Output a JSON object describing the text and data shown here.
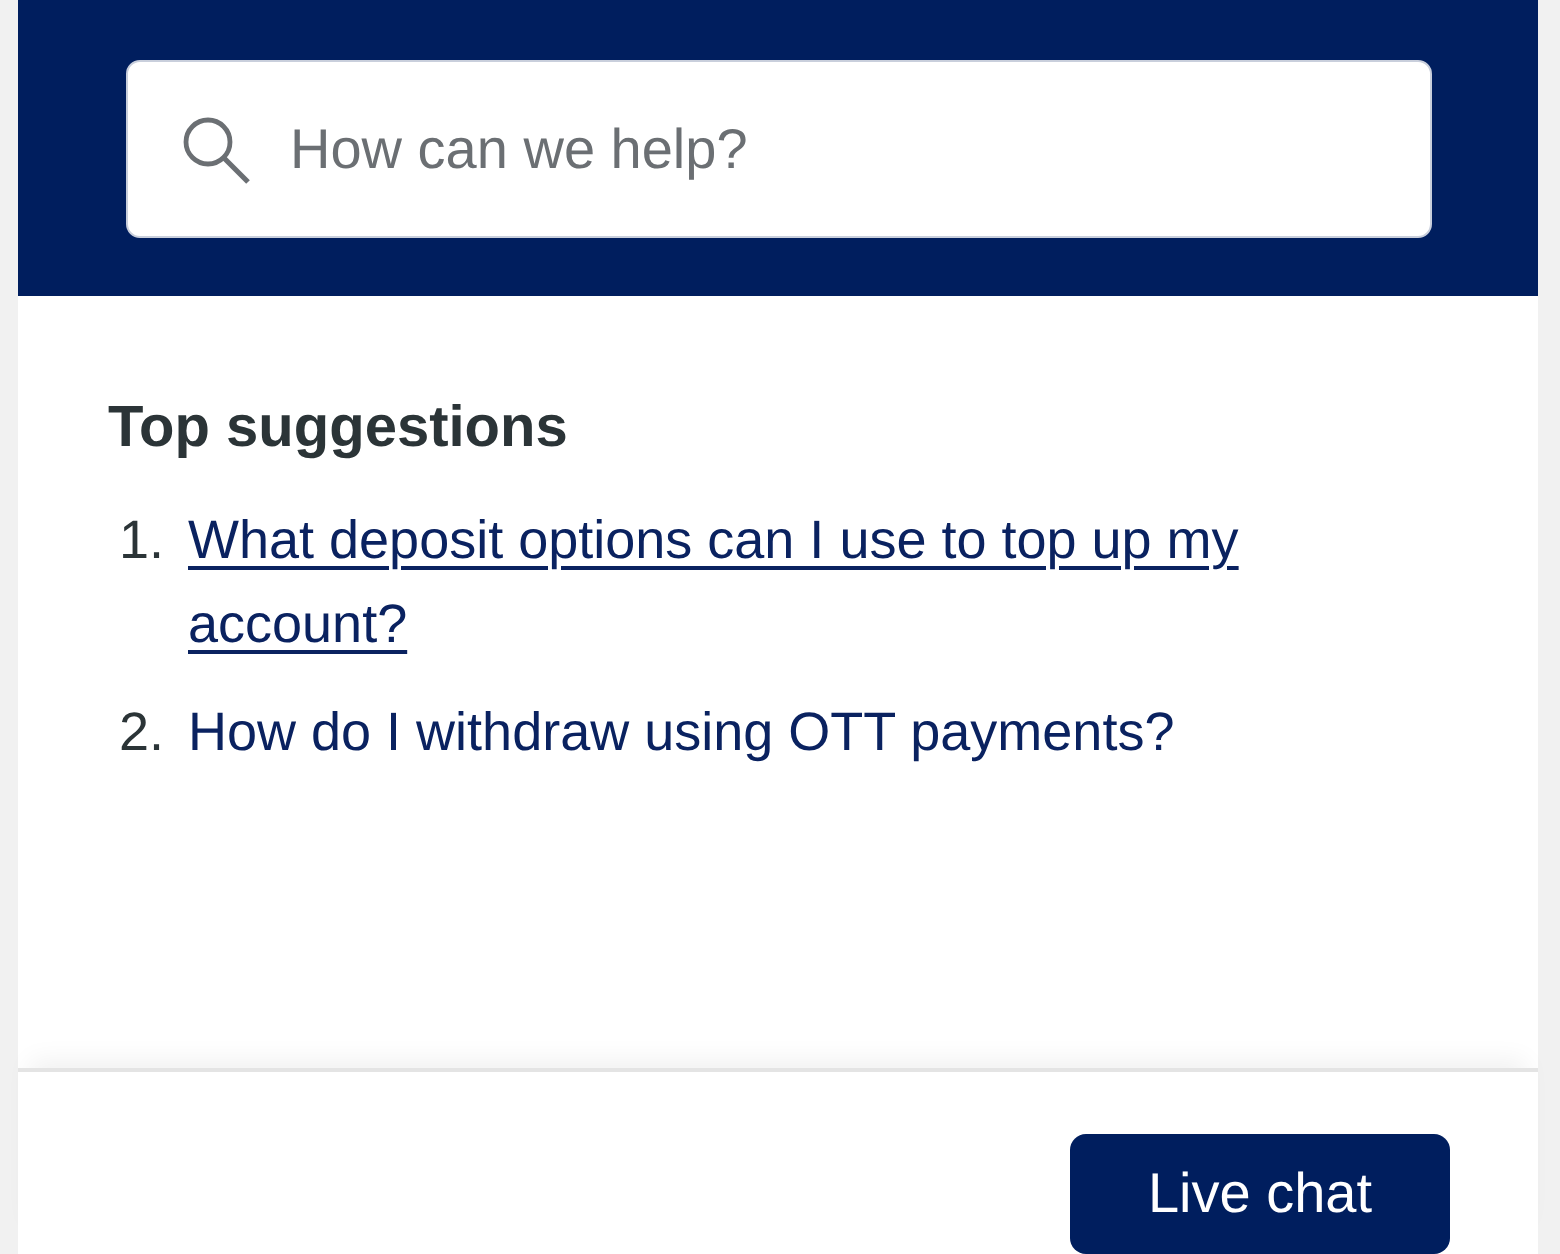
{
  "search": {
    "placeholder": "How can we help?"
  },
  "suggestions": {
    "title": "Top suggestions",
    "items": [
      {
        "number": "1.",
        "text": "What deposit options can I use to top up my account?",
        "underlined": true
      },
      {
        "number": "2.",
        "text": "How do I withdraw using OTT payments?",
        "underlined": false
      }
    ]
  },
  "footer": {
    "button": "Live chat"
  }
}
